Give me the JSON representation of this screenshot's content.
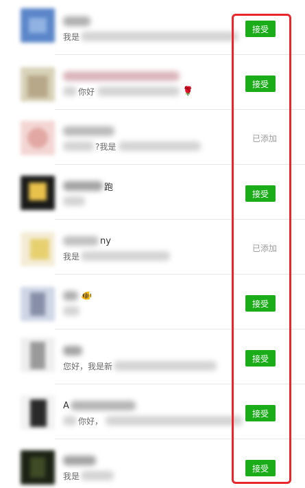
{
  "contacts": [
    {
      "name_visible": "",
      "message_visible": "我是",
      "action": "接受",
      "status": "accept"
    },
    {
      "name_visible": "",
      "message_visible": "你好",
      "action": "接受",
      "status": "accept"
    },
    {
      "name_visible": "",
      "message_visible": "?我是",
      "action": "已添加",
      "status": "added"
    },
    {
      "name_visible": "跑",
      "message_visible": "",
      "action": "接受",
      "status": "accept"
    },
    {
      "name_visible": "ny",
      "message_visible": "我是",
      "action": "已添加",
      "status": "added"
    },
    {
      "name_visible": "",
      "message_visible": "",
      "action": "接受",
      "status": "accept"
    },
    {
      "name_visible": "",
      "message_visible": "您好，我是新",
      "action": "接受",
      "status": "accept"
    },
    {
      "name_visible": "A",
      "message_visible": "你好，",
      "action": "接受",
      "status": "accept"
    },
    {
      "name_visible": "",
      "message_visible": "我是",
      "action": "接受",
      "status": "accept"
    }
  ],
  "colors": {
    "accept_button": "#1aad19",
    "added_text": "#9a9a9a",
    "highlight_border": "#e8262b",
    "divider": "#e6e6e6"
  }
}
